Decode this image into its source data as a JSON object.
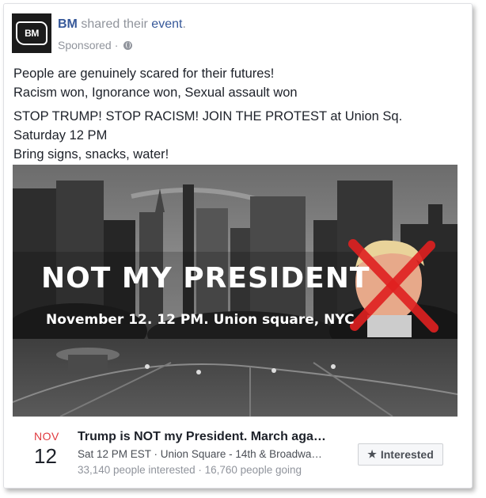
{
  "post": {
    "avatar_text": "BM",
    "page_name": "BM",
    "shared_text": "shared their",
    "event_link": "event",
    "period": ".",
    "sponsored": "Sponsored",
    "dot": "·",
    "privacy_icon": "globe-icon",
    "text_lines": [
      "People are genuinely scared for their futures!",
      "Racism won, Ignorance won, Sexual assault won",
      "STOP TRUMP! STOP RACISM! JOIN THE PROTEST at Union Sq.",
      "Saturday 12 PM",
      "Bring signs, snacks, water!"
    ]
  },
  "image": {
    "headline": "NOT MY PRESIDENT",
    "subline": "November 12. 12 PM. Union square, NYC",
    "cross_color": "#e02020"
  },
  "event": {
    "month": "NOV",
    "day": "12",
    "title": "Trump is NOT my President. March aga…",
    "details": "Sat 12 PM EST · Union Square - 14th & Broadwa…",
    "stats": "33,140 people interested · 16,760 people going",
    "interested_label": "Interested",
    "interested_icon": "star-icon"
  },
  "colors": {
    "link": "#365899",
    "muted": "#90949c",
    "month": "#e0393e"
  }
}
